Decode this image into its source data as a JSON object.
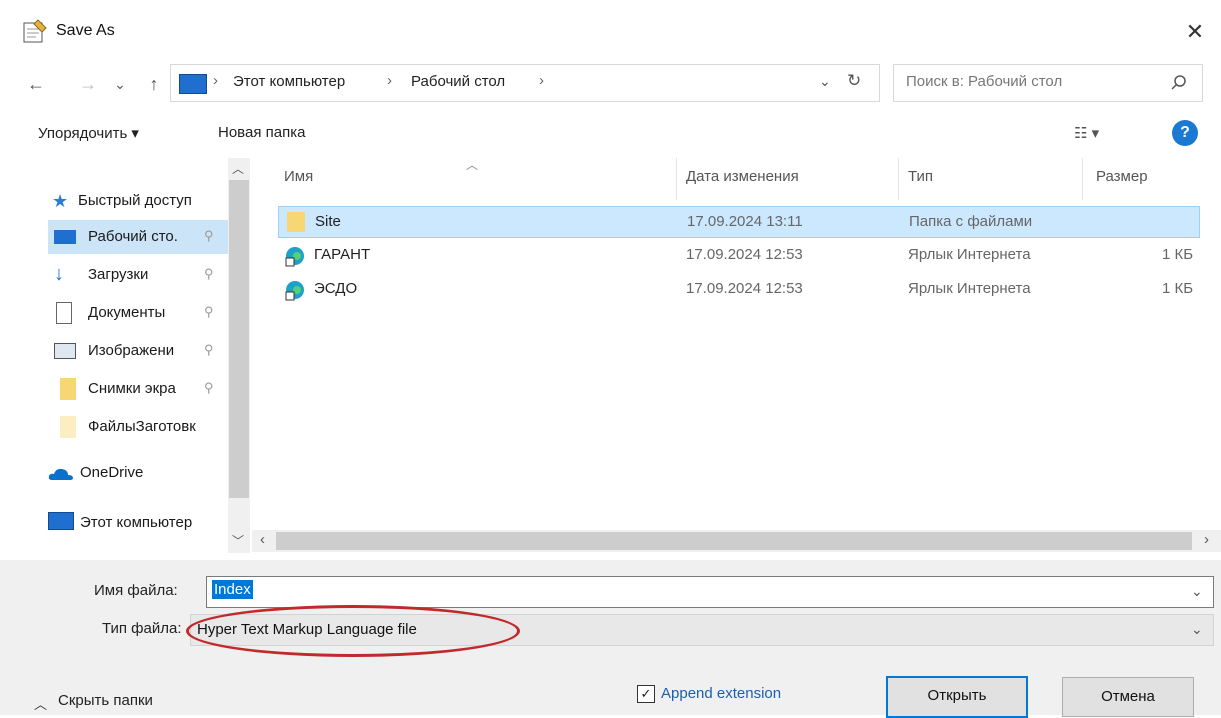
{
  "window": {
    "title": "Save As",
    "close_glyph": "✕"
  },
  "nav": {
    "back": "←",
    "forward": "→",
    "recent": "⌄",
    "up": "↑",
    "breadcrumb": [
      "Этот компьютер",
      "Рабочий стол"
    ],
    "refresh": "↻",
    "dropdown": "⌄"
  },
  "search": {
    "placeholder": "Поиск в: Рабочий стол"
  },
  "toolbar": {
    "organize": "Упорядочить ▾",
    "new_folder": "Новая папка",
    "view": "☷ ▾",
    "help": "?"
  },
  "sidebar": {
    "items": [
      {
        "label": "Быстрый доступ",
        "icon": "star-icon",
        "pinned": false
      },
      {
        "label": "Рабочий сто.",
        "icon": "desktop-icon",
        "pinned": true,
        "selected": true
      },
      {
        "label": "Загрузки",
        "icon": "download-icon",
        "pinned": true
      },
      {
        "label": "Документы",
        "icon": "document-icon",
        "pinned": true
      },
      {
        "label": "Изображени",
        "icon": "pictures-icon",
        "pinned": true
      },
      {
        "label": "Снимки экра",
        "icon": "folder-icon",
        "pinned": true
      },
      {
        "label": "ФайлыЗаготовк",
        "icon": "folder-icon",
        "pinned": false
      },
      {
        "label": "OneDrive",
        "icon": "cloud-icon",
        "pinned": false
      },
      {
        "label": "Этот компьютер",
        "icon": "computer-icon",
        "pinned": false
      }
    ],
    "pin_glyph": "📌"
  },
  "file_list": {
    "columns": [
      "Имя",
      "Дата изменения",
      "Тип",
      "Размер"
    ],
    "rows": [
      {
        "name": "Site",
        "date": "17.09.2024 13:11",
        "type": "Папка с файлами",
        "size": "",
        "icon": "folder-icon",
        "selected": true
      },
      {
        "name": "ГАРАНТ",
        "date": "17.09.2024 12:53",
        "type": "Ярлык Интернета",
        "size": "1 КБ",
        "icon": "edge-shortcut-icon"
      },
      {
        "name": "ЭСДО",
        "date": "17.09.2024 12:53",
        "type": "Ярлык Интернета",
        "size": "1 КБ",
        "icon": "edge-shortcut-icon"
      }
    ]
  },
  "form": {
    "filename_label": "Имя файла:",
    "filename_value": "Index",
    "filetype_label": "Тип файла:",
    "filetype_value": "Hyper Text Markup Language file"
  },
  "footer": {
    "hide_folders": "Скрыть папки",
    "append_extension": "Append extension",
    "append_checked": true,
    "open_button": "Открыть",
    "cancel_button": "Отмена"
  },
  "colors": {
    "accent": "#0078d7",
    "selection": "#cce8ff",
    "annotation": "#c12a2a"
  }
}
